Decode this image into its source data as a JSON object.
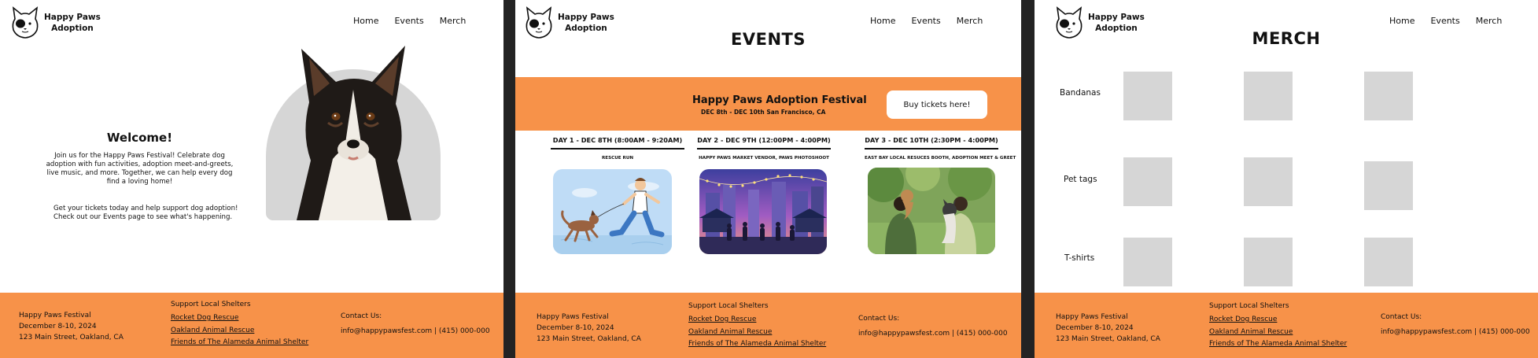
{
  "logo": {
    "line1": "Happy Paws",
    "line2": "Adoption"
  },
  "nav": {
    "home": "Home",
    "events": "Events",
    "merch": "Merch"
  },
  "footer": {
    "name": "Happy Paws Festival",
    "dates": "December 8-10, 2024",
    "address": "123 Main Street, Oakland, CA",
    "support_title": "Support Local Shelters",
    "shelters": [
      "Rocket Dog Rescue",
      "Oakland Animal Rescue",
      "Friends of The Alameda Animal Shelter"
    ],
    "contact_title": "Contact Us:",
    "contact": "info@happypawsfest.com | (415) 000-000"
  },
  "home": {
    "title": "Welcome!",
    "intro": "Join us for the Happy Paws Festival! Celebrate dog adoption with fun activities, adoption meet-and-greets, live music, and more. Together, we can help every dog find a loving home!",
    "tickets": "Get your tickets today and help support dog adoption! Check out our Events page to see what's happening."
  },
  "events": {
    "title": "EVENTS",
    "banner_title": "Happy Paws Adoption Festival",
    "banner_sub": "DEC 8th - DEC 10th San Francisco, CA",
    "buy_label": "Buy tickets here!",
    "days": [
      {
        "title": "DAY 1 - DEC 8TH (8:00AM - 9:20AM)",
        "sub": "RESCUE RUN"
      },
      {
        "title": "DAY 2 - DEC 9TH (12:00PM - 4:00PM)",
        "sub": "HAPPY PAWS MARKET VENDOR, PAWS PHOTOSHOOT"
      },
      {
        "title": "DAY 3 - DEC 10TH (2:30PM - 4:00PM)",
        "sub": "EAST BAY LOCAL RESUCES BOOTH, ADOPTION MEET & GREET"
      }
    ]
  },
  "merch": {
    "title": "MERCH",
    "categories": [
      "Bandanas",
      "Pet tags",
      "T-shirts"
    ]
  },
  "colors": {
    "accent": "#f79249",
    "placeholder": "#d6d6d6",
    "divider": "#232323"
  }
}
